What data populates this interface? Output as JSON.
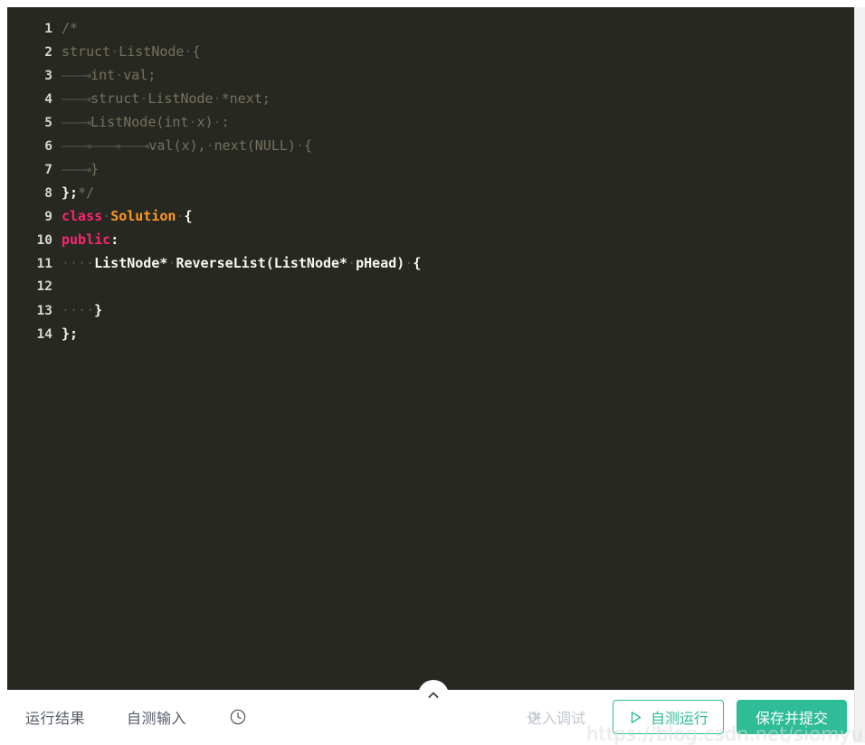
{
  "editor": {
    "language": "cpp",
    "theme_background": "#272822",
    "colors": {
      "comment": "#75715e",
      "keyword": "#f92672",
      "type": "#fd971f",
      "plain": "#f8f8f2",
      "whitespace_marker": "#56534a",
      "gutter": "#d7d7d2"
    },
    "lines": [
      {
        "num": "1",
        "text": "/*"
      },
      {
        "num": "2",
        "text": "struct·ListNode·{"
      },
      {
        "num": "3",
        "text": "\tint·val;"
      },
      {
        "num": "4",
        "text": "\tstruct·ListNode·*next;"
      },
      {
        "num": "5",
        "text": "\tListNode(int·x)·:"
      },
      {
        "num": "6",
        "text": "\t\t\tval(x),·next(NULL)·{"
      },
      {
        "num": "7",
        "text": "\t}"
      },
      {
        "num": "8",
        "text": "};*/"
      },
      {
        "num": "9",
        "text": "class·Solution·{"
      },
      {
        "num": "10",
        "text": "public:"
      },
      {
        "num": "11",
        "text": "····ListNode*·ReverseList(ListNode*·pHead)·{"
      },
      {
        "num": "12",
        "text": ""
      },
      {
        "num": "13",
        "text": "····}"
      },
      {
        "num": "14",
        "text": "};"
      }
    ]
  },
  "bottom_bar": {
    "tabs": [
      {
        "label": "运行结果",
        "id": "run-result"
      },
      {
        "label": "自测输入",
        "id": "self-test-input"
      }
    ],
    "history_icon": "clock-icon",
    "debug": {
      "label": "进入调试",
      "icon": "bug-icon",
      "disabled": true,
      "color": "#c2c8d0"
    },
    "run": {
      "label": "自测运行",
      "icon": "play-icon",
      "color": "#2ebd96"
    },
    "submit": {
      "label": "保存并提交",
      "color": "#2ebd96"
    }
  },
  "collapse_handle": {
    "icon": "chevron-up-icon"
  },
  "watermark": {
    "text": "https://blog.csdn.net/siomyu"
  }
}
